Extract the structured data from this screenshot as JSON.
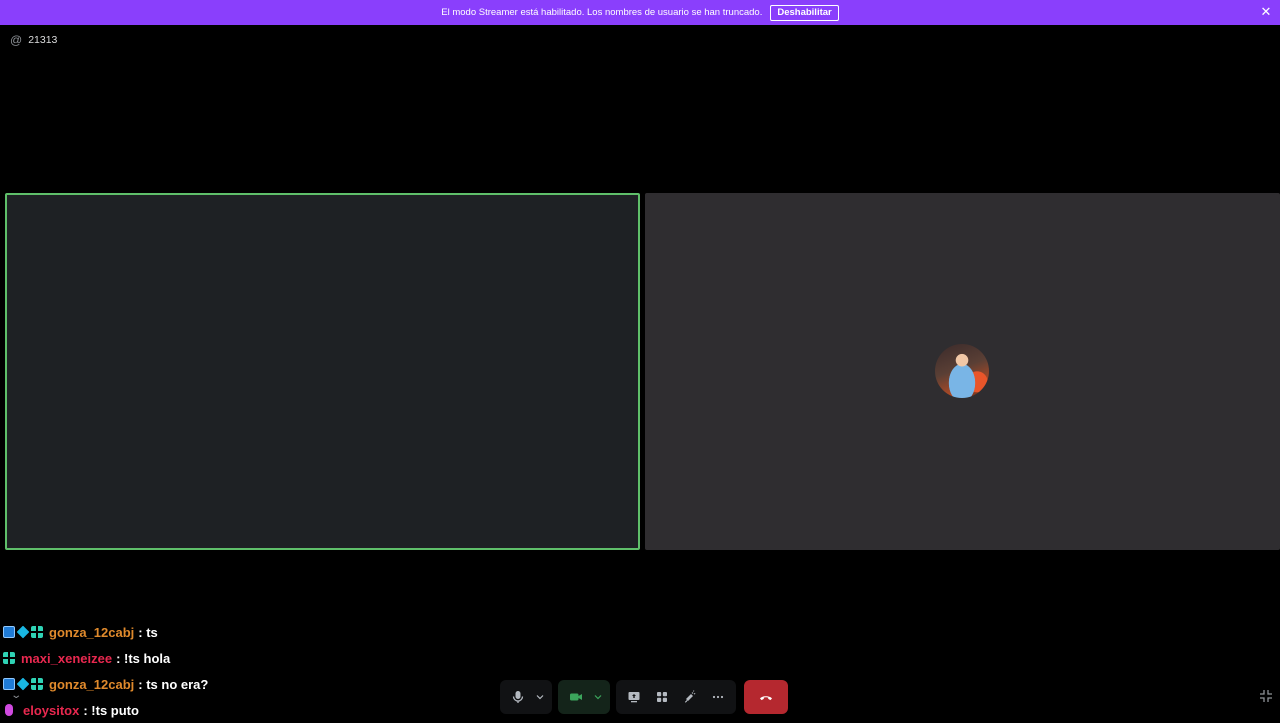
{
  "banner": {
    "text": "El modo Streamer está habilitado. Los nombres de usuario se han truncado.",
    "button_label": "Deshabilitar",
    "close_glyph": "✕",
    "color": "#8a3ffc"
  },
  "channel": {
    "icon": "at-icon",
    "icon_glyph": "@",
    "name": "21313"
  },
  "tiles": {
    "left": {
      "border_color": "#5fbf6a",
      "state": "speaking"
    },
    "right": {
      "has_avatar": true
    }
  },
  "chat": {
    "messages": [
      {
        "user": "gonza_12cabj",
        "text": ": ts",
        "user_color": "#e08a2c",
        "badges": [
          "prime-badge-icon",
          "cube-badge-icon",
          "grid-badge-icon"
        ]
      },
      {
        "user": "maxi_xeneizee",
        "text": ": !ts hola",
        "user_color": "#e8284f",
        "badges": [
          "grid-badge-icon"
        ]
      },
      {
        "user": "gonza_12cabj",
        "text": ": ts no era?",
        "user_color": "#e08a2c",
        "badges": [
          "prime-badge-icon",
          "cube-badge-icon",
          "grid-badge-icon"
        ]
      },
      {
        "user": "eloysitox",
        "text": ": !ts puto",
        "user_color": "#e8284f",
        "badges": [
          "mic-badge-icon"
        ]
      }
    ]
  },
  "controls": {
    "icons": [
      "microphone-icon",
      "camera-icon",
      "screen-share-icon",
      "activities-icon",
      "soundboard-icon",
      "more-icon",
      "hang-up-icon"
    ],
    "hangup_color": "#b5282f"
  },
  "fullscreen_icon": "fullscreen-exit-icon"
}
